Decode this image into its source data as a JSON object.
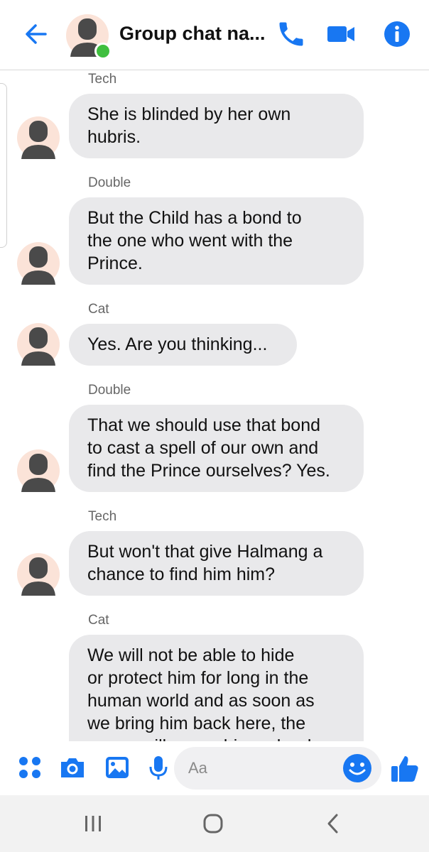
{
  "header": {
    "title": "Group chat na...",
    "accent_color": "#1877f2",
    "online_color": "#3fbf3f",
    "icons": [
      "back-arrow-icon",
      "phone-icon",
      "video-camera-icon",
      "info-icon"
    ]
  },
  "messages": [
    {
      "sender": "Tech",
      "text": "She is blinded by her own\nhubris."
    },
    {
      "sender": "Double",
      "text": "But the Child has a bond to\nthe one who went with the\nPrince."
    },
    {
      "sender": "Cat",
      "text": "Yes. Are you thinking..."
    },
    {
      "sender": "Double",
      "text": "That we should use that bond\nto cast a spell of our own and\nfind the Prince ourselves? Yes."
    },
    {
      "sender": "Tech",
      "text": "But won't that give Halmang a\nchance to find him him?"
    },
    {
      "sender": "Cat",
      "text": "We will not be able to hide\nor protect him for long in the\nhuman world and as soon as\nwe bring him back here, the\nqueen will sense him - she do"
    }
  ],
  "composer": {
    "placeholder": "Aa",
    "icons": [
      "apps-icon",
      "camera-icon",
      "gallery-icon",
      "microphone-icon",
      "emoji-icon",
      "thumbs-up-icon"
    ]
  },
  "navbar": {
    "icons": [
      "recent-apps-icon",
      "home-icon",
      "back-icon"
    ]
  }
}
